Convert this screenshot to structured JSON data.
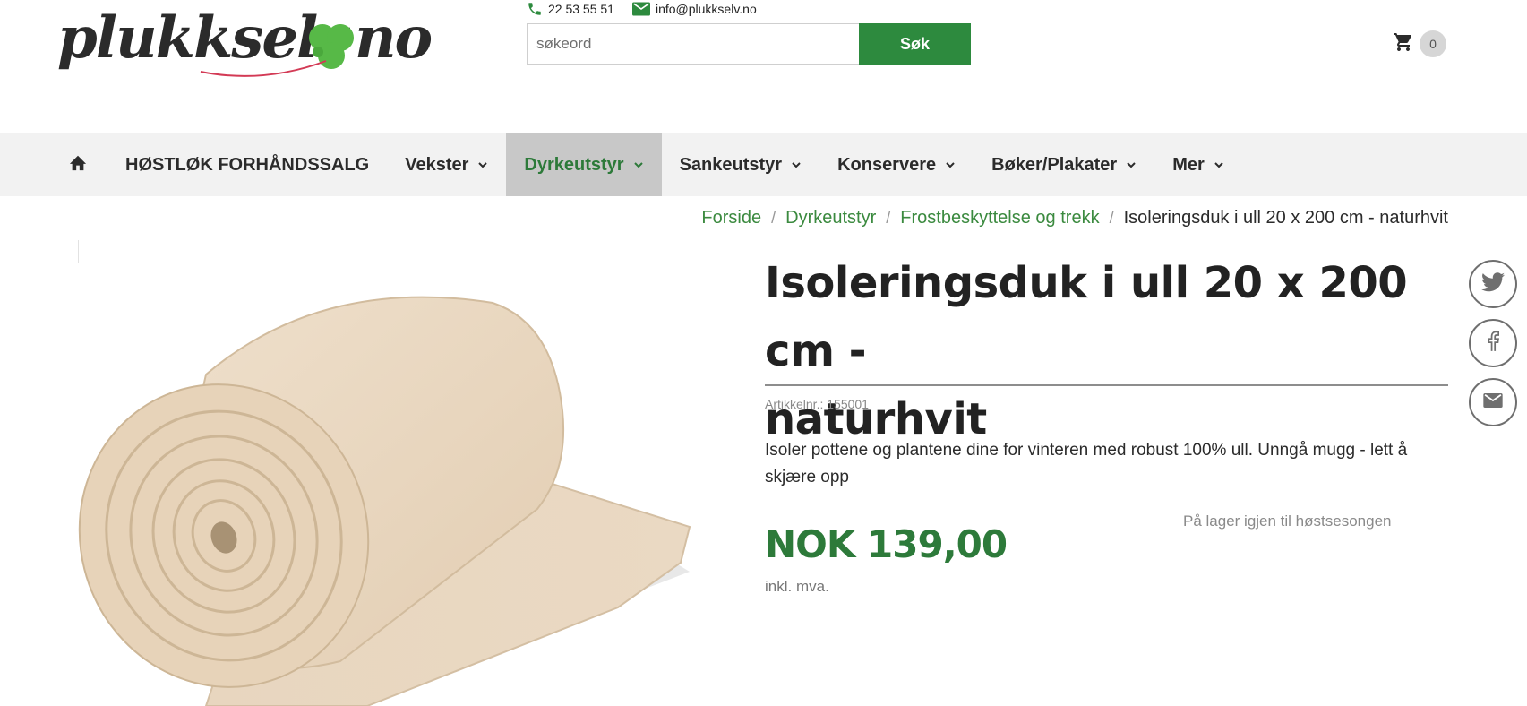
{
  "header": {
    "logo": {
      "text_left": "plukkselv",
      "text_right": "no",
      "alt": "plukkselv.no"
    },
    "contact": {
      "phone": "22 53 55 51",
      "email": "info@plukkselv.no"
    },
    "search": {
      "placeholder": "søkeord",
      "value": "",
      "button_label": "Søk"
    },
    "cart": {
      "count": "0"
    }
  },
  "nav": {
    "items": [
      {
        "label": "HØSTLØK FORHÅNDSSALG"
      },
      {
        "label": "Vekster"
      },
      {
        "label": "Dyrkeutstyr"
      },
      {
        "label": "Sankeutstyr"
      },
      {
        "label": "Konservere"
      },
      {
        "label": "Bøker/Plakater"
      },
      {
        "label": "Mer"
      }
    ],
    "active_index": 2
  },
  "breadcrumb": {
    "items": [
      "Forside",
      "Dyrkeutstyr",
      "Frostbeskyttelse og trekk"
    ],
    "current": "Isoleringsduk i ull 20 x 200 cm - naturhvit",
    "separator": "/"
  },
  "product": {
    "title_line1": "Isoleringsduk i ull 20 x 200 cm -",
    "title_line2": "naturhvit",
    "sku_label": "Artikkelnr.: 155001",
    "description": "Isoler pottene og plantene dine for vinteren med robust 100% ull. Unngå mugg - lett å skjære opp",
    "stock_status": "På lager igjen til høstsesongen",
    "price": "NOK 139,00",
    "vat_note": "inkl. mva."
  },
  "colors": {
    "brand_green": "#2d8a3e",
    "link_green": "#3b8a3f",
    "price_green": "#2d7a3a",
    "nav_bg": "#f2f2f2",
    "nav_active_bg": "#c8c8c8"
  },
  "icons": {
    "home": "home-icon",
    "phone": "phone-icon",
    "email": "envelope-icon",
    "cart": "cart-icon",
    "chevron": "chevron-down-icon",
    "twitter": "twitter-icon",
    "facebook": "facebook-icon",
    "share_email": "mail-icon"
  }
}
